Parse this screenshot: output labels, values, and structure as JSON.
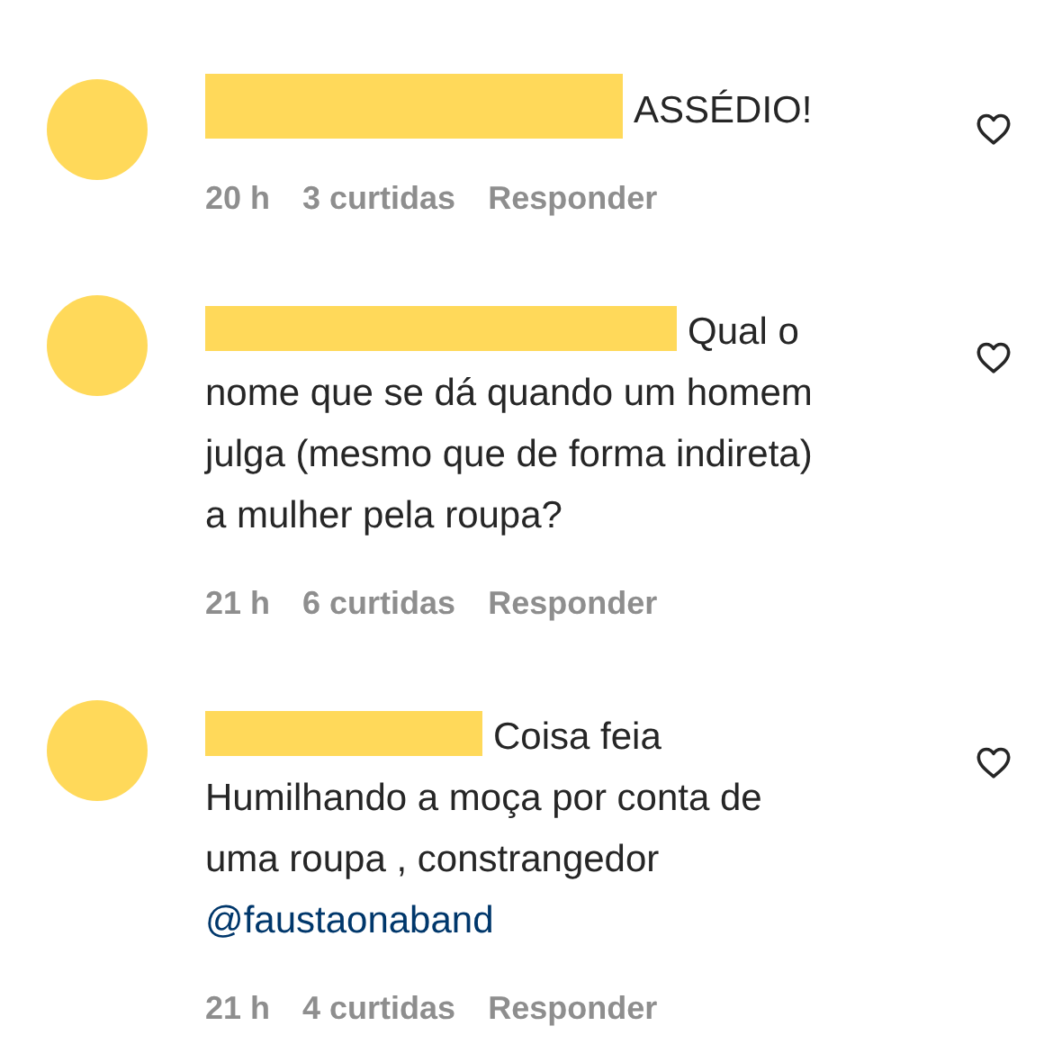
{
  "comments": [
    {
      "lines": [
        "ASSÉDIO!"
      ],
      "time": "20 h",
      "likes": "3 curtidas",
      "reply": "Responder"
    },
    {
      "lines": [
        "Qual o",
        "nome que se dá quando um homem",
        "julga (mesmo que de forma indireta)",
        "a mulher pela roupa?"
      ],
      "time": "21 h",
      "likes": "6 curtidas",
      "reply": "Responder"
    },
    {
      "lines": [
        "Coisa feia",
        "Humilhando a moça por conta de",
        "uma roupa , constrangedor"
      ],
      "mention": "@faustaonaband",
      "time": "21 h",
      "likes": "4 curtidas",
      "reply": "Responder"
    }
  ]
}
